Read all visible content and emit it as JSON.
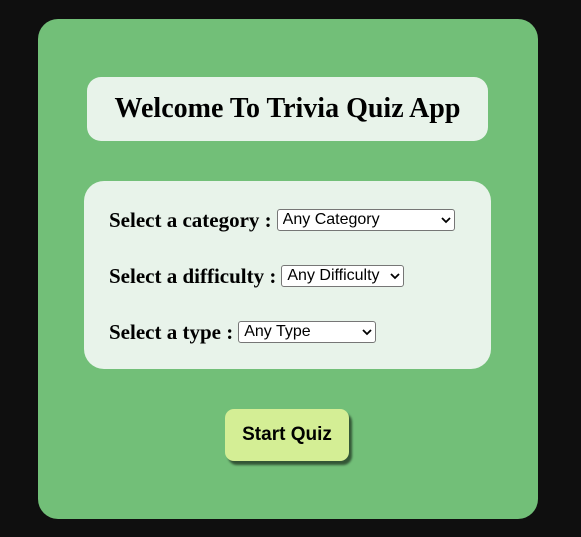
{
  "header": {
    "title": "Welcome To Trivia Quiz App"
  },
  "form": {
    "category": {
      "label": "Select a category :",
      "selected": "Any Category"
    },
    "difficulty": {
      "label": "Select a difficulty :",
      "selected": "Any Difficulty"
    },
    "type": {
      "label": "Select a type :",
      "selected": "Any Type"
    }
  },
  "actions": {
    "start_label": "Start Quiz"
  },
  "colors": {
    "page_background": "#0f0f0f",
    "card_background": "#72bf78",
    "panel_background": "#e8f3ea",
    "button_background": "#d4ee95"
  },
  "icons": {
    "dropdown": "chevron-down-icon"
  }
}
